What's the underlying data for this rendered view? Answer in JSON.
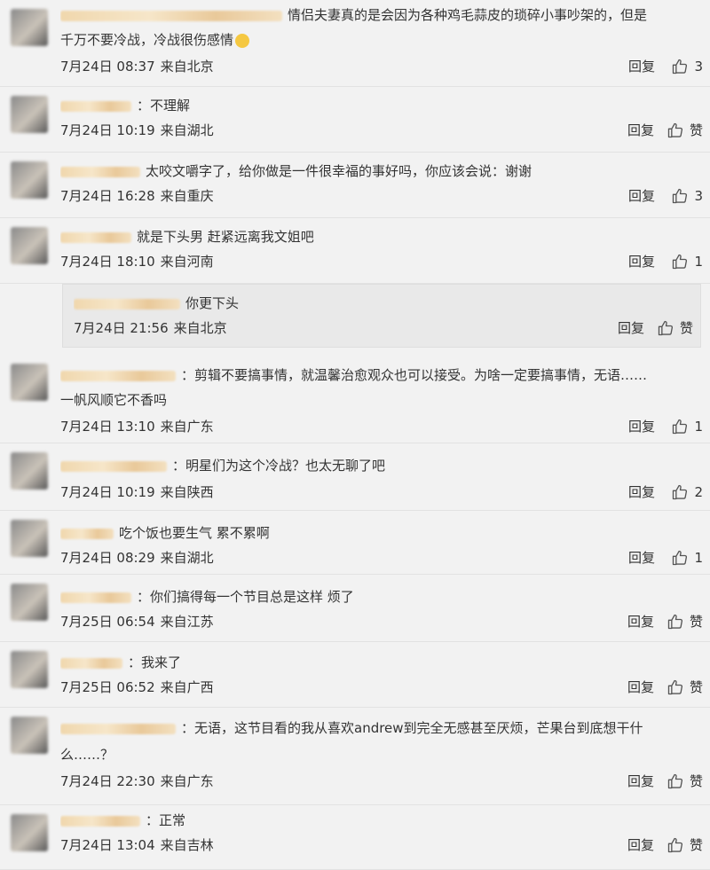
{
  "comments": [
    {
      "text": [
        "情侣夫妻真的是会因为各种鸡毛蒜皮的琐碎小事吵架的，但是",
        "千万不要冷战，冷战很伤感情"
      ],
      "time": "7月24日 08:37",
      "location": "来自北京",
      "reply_label": "回复",
      "likes": "3",
      "emoji": true
    },
    {
      "text": [
        "：不理解"
      ],
      "time": "7月24日 10:19",
      "location": "来自湖北",
      "reply_label": "回复",
      "likes": "赞"
    },
    {
      "text": [
        "太咬文嚼字了，给你做是一件很幸福的事好吗，你应该会说：谢谢"
      ],
      "time": "7月24日 16:28",
      "location": "来自重庆",
      "reply_label": "回复",
      "likes": "3"
    },
    {
      "text": [
        "就是下头男 赶紧远离我文姐吧"
      ],
      "time": "7月24日 18:10",
      "location": "来自河南",
      "reply_label": "回复",
      "likes": "1"
    },
    {
      "text": [
        "你更下头"
      ],
      "time": "7月24日 21:56",
      "location": "来自北京",
      "reply_label": "回复",
      "likes": "赞",
      "is_reply": true
    },
    {
      "text": [
        "：剪辑不要搞事情，就温馨治愈观众也可以接受。为啥一定要搞事情，无语……",
        "一帆风顺它不香吗"
      ],
      "time": "7月24日 13:10",
      "location": "来自广东",
      "reply_label": "回复",
      "likes": "1"
    },
    {
      "text": [
        "：明星们为这个冷战？也太无聊了吧"
      ],
      "time": "7月24日 10:19",
      "location": "来自陕西",
      "reply_label": "回复",
      "likes": "2"
    },
    {
      "text": [
        "吃个饭也要生气 累不累啊"
      ],
      "time": "7月24日 08:29",
      "location": "来自湖北",
      "reply_label": "回复",
      "likes": "1"
    },
    {
      "text": [
        "：你们搞得每一个节目总是这样 烦了"
      ],
      "time": "7月25日 06:54",
      "location": "来自江苏",
      "reply_label": "回复",
      "likes": "赞"
    },
    {
      "text": [
        "：我来了"
      ],
      "time": "7月25日 06:52",
      "location": "来自广西",
      "reply_label": "回复",
      "likes": "赞"
    },
    {
      "text": [
        "：无语，这节目看的我从喜欢andrew到完全无感甚至厌烦，芒果台到底想干什",
        "么……？"
      ],
      "time": "7月24日 22:30",
      "location": "来自广东",
      "reply_label": "回复",
      "likes": "赞"
    },
    {
      "text": [
        "：正常"
      ],
      "time": "7月24日 13:04",
      "location": "来自吉林",
      "reply_label": "回复",
      "likes": "赞"
    }
  ],
  "icons": {
    "like": "thumbs-up-icon"
  }
}
